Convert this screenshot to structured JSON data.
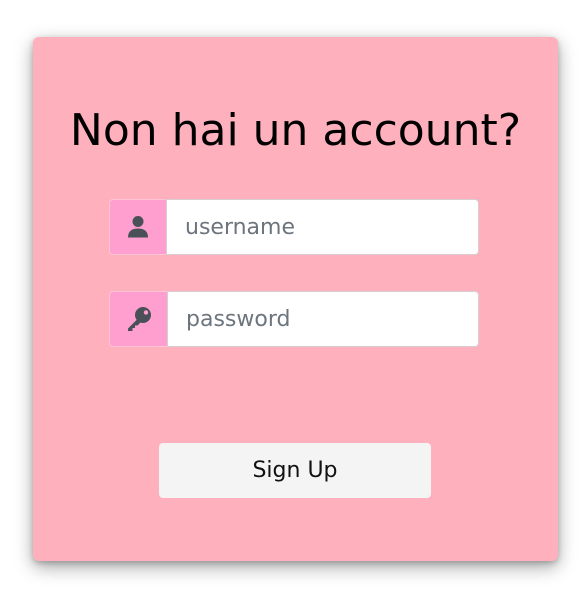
{
  "form": {
    "title": "Non hai un account?",
    "username": {
      "placeholder": "username",
      "value": "",
      "icon": "user-icon"
    },
    "password": {
      "placeholder": "password",
      "value": "",
      "icon": "key-icon"
    },
    "submit_label": "Sign Up"
  },
  "colors": {
    "card_background": "#ffb0bd",
    "icon_addon": "#ff9fcf",
    "icon": "#495057",
    "button_background": "#f4f4f4"
  }
}
